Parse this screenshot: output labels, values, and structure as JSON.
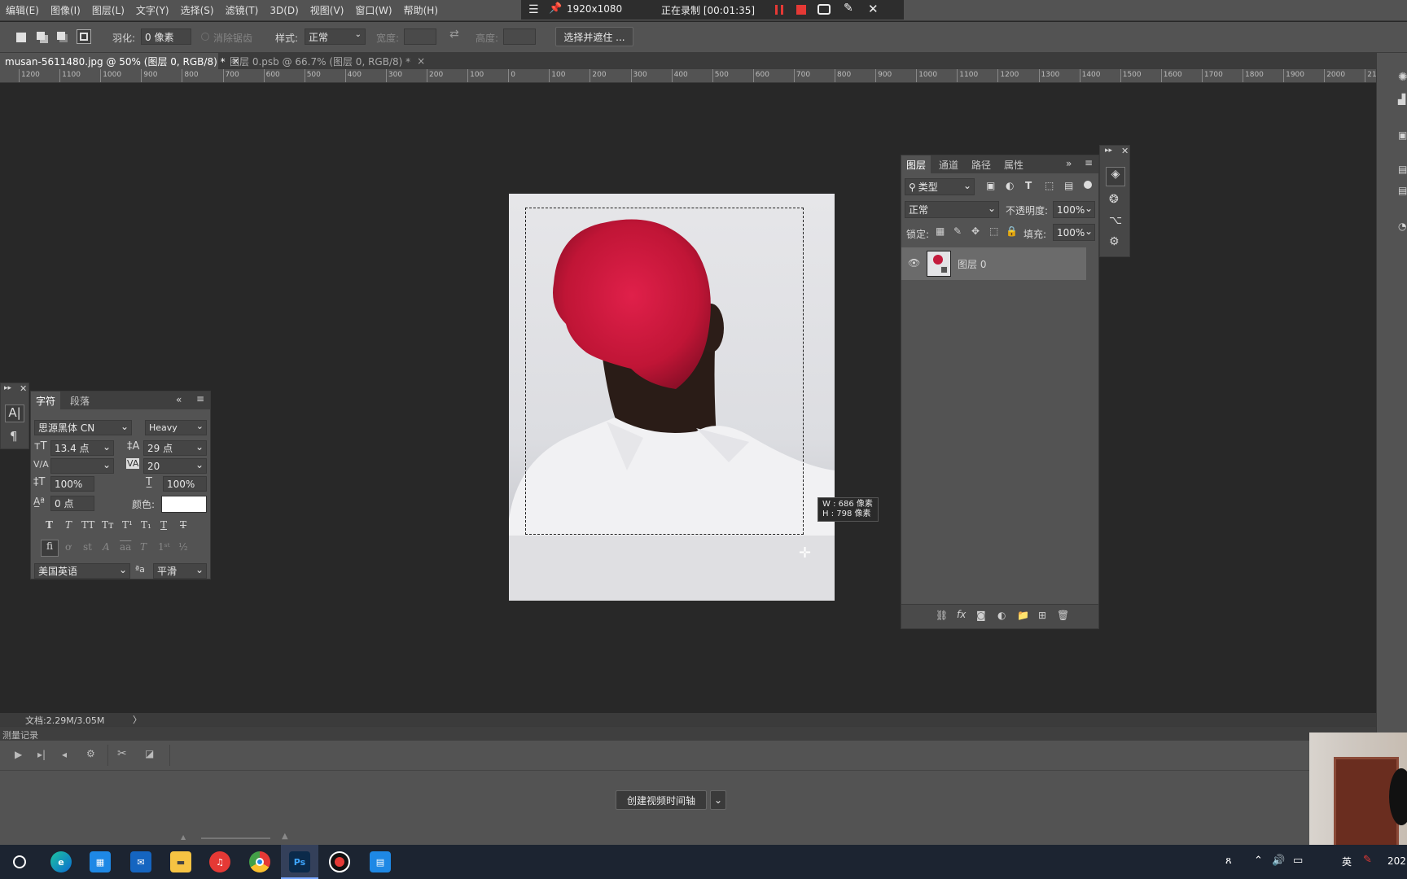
{
  "menu": [
    "编辑(E)",
    "图像(I)",
    "图层(L)",
    "文字(Y)",
    "选择(S)",
    "滤镜(T)",
    "3D(D)",
    "视图(V)",
    "窗口(W)",
    "帮助(H)"
  ],
  "recorder": {
    "resolution": "1920x1080",
    "status": "正在录制 [00:01:35]"
  },
  "options": {
    "feather_label": "羽化:",
    "feather_value": "0 像素",
    "antialias_label": "消除锯齿",
    "style_label": "样式:",
    "style_value": "正常",
    "width_label": "宽度:",
    "height_label": "高度:",
    "select_mask_button": "选择并遮住 ..."
  },
  "tabs": [
    {
      "label": "musan-5611480.jpg @ 50% (图层 0, RGB/8) *",
      "close": "×"
    },
    {
      "label": "图层 0.psb @ 66.7% (图层 0, RGB/8) *",
      "close": "×"
    }
  ],
  "ruler_labels": [
    "1200",
    "1100",
    "1000",
    "900",
    "800",
    "700",
    "600",
    "500",
    "400",
    "300",
    "200",
    "100",
    "0",
    "100",
    "200",
    "300",
    "400",
    "500",
    "600",
    "700",
    "800",
    "900",
    "1000",
    "1100",
    "1200",
    "1300",
    "1400",
    "1500",
    "1600",
    "1700",
    "1800",
    "1900",
    "2000",
    "21"
  ],
  "tooltip": {
    "w": "W :  686 像素",
    "h": "H :  798 像素"
  },
  "character_panel": {
    "tabs": [
      "字符",
      "段落"
    ],
    "font_family": "思源黑体 CN",
    "font_style": "Heavy",
    "font_size": "13.4 点",
    "leading": "29 点",
    "kerning": "",
    "tracking": "20",
    "vscale": "100%",
    "hscale": "100%",
    "baseline": "0 点",
    "color_label": "颜色:",
    "language": "美国英语",
    "aa_label": "ªa",
    "antialias": "平滑"
  },
  "layers_panel": {
    "tabs": [
      "图层",
      "通道",
      "路径",
      "属性"
    ],
    "filter_kind": "类型",
    "blend_mode": "正常",
    "opacity_label": "不透明度:",
    "opacity": "100%",
    "lock_label": "锁定:",
    "fill_label": "填充:",
    "fill": "100%",
    "layers": [
      {
        "name": "图层 0",
        "visible": true
      }
    ],
    "fx_label": "fx"
  },
  "status": {
    "doc": "文档:2.29M/3.05M",
    "arrow": "〉"
  },
  "timeline": {
    "title": "测量记录",
    "create_button": "创建视频时间轴"
  },
  "taskbar": {
    "time_fragment": "202",
    "lang": "英"
  }
}
